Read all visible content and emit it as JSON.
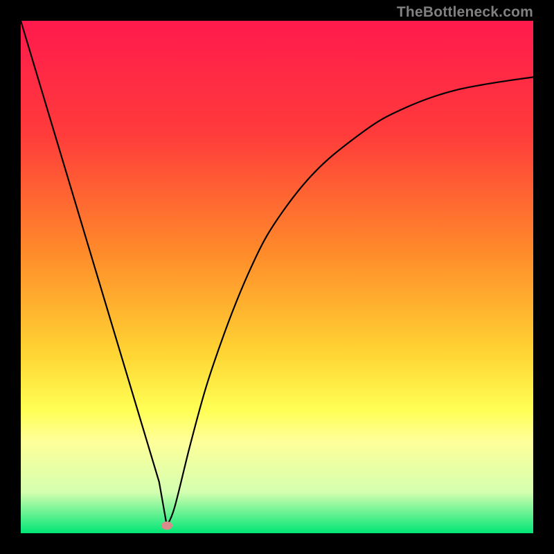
{
  "watermark": "TheBottleneck.com",
  "chart_data": {
    "type": "line",
    "title": "",
    "xlabel": "",
    "ylabel": "",
    "xlim": [
      0,
      100
    ],
    "ylim": [
      0,
      100
    ],
    "gradient_stops": [
      {
        "offset": 0,
        "color": "#ff1a4d"
      },
      {
        "offset": 22,
        "color": "#ff3b3b"
      },
      {
        "offset": 45,
        "color": "#ff8a2a"
      },
      {
        "offset": 65,
        "color": "#ffd533"
      },
      {
        "offset": 76,
        "color": "#ffff55"
      },
      {
        "offset": 82,
        "color": "#ffff99"
      },
      {
        "offset": 92,
        "color": "#d4ffb0"
      },
      {
        "offset": 100,
        "color": "#00e676"
      }
    ],
    "series": [
      {
        "name": "bottleneck-curve",
        "x": [
          0,
          3,
          6,
          9,
          12,
          15,
          18,
          21,
          24,
          27,
          28.5,
          30,
          33,
          36,
          39,
          42,
          45,
          48,
          52,
          56,
          60,
          65,
          70,
          75,
          80,
          85,
          90,
          95,
          100
        ],
        "values": [
          100,
          90,
          80,
          70,
          60,
          50,
          40,
          30,
          20,
          10,
          1.5,
          5,
          17,
          28,
          37,
          45,
          52,
          58,
          64,
          69,
          73,
          77,
          80.5,
          83,
          85,
          86.5,
          87.5,
          88.3,
          89
        ]
      }
    ],
    "marker": {
      "x": 28.5,
      "y": 1.5,
      "color": "#d98a8a"
    }
  }
}
